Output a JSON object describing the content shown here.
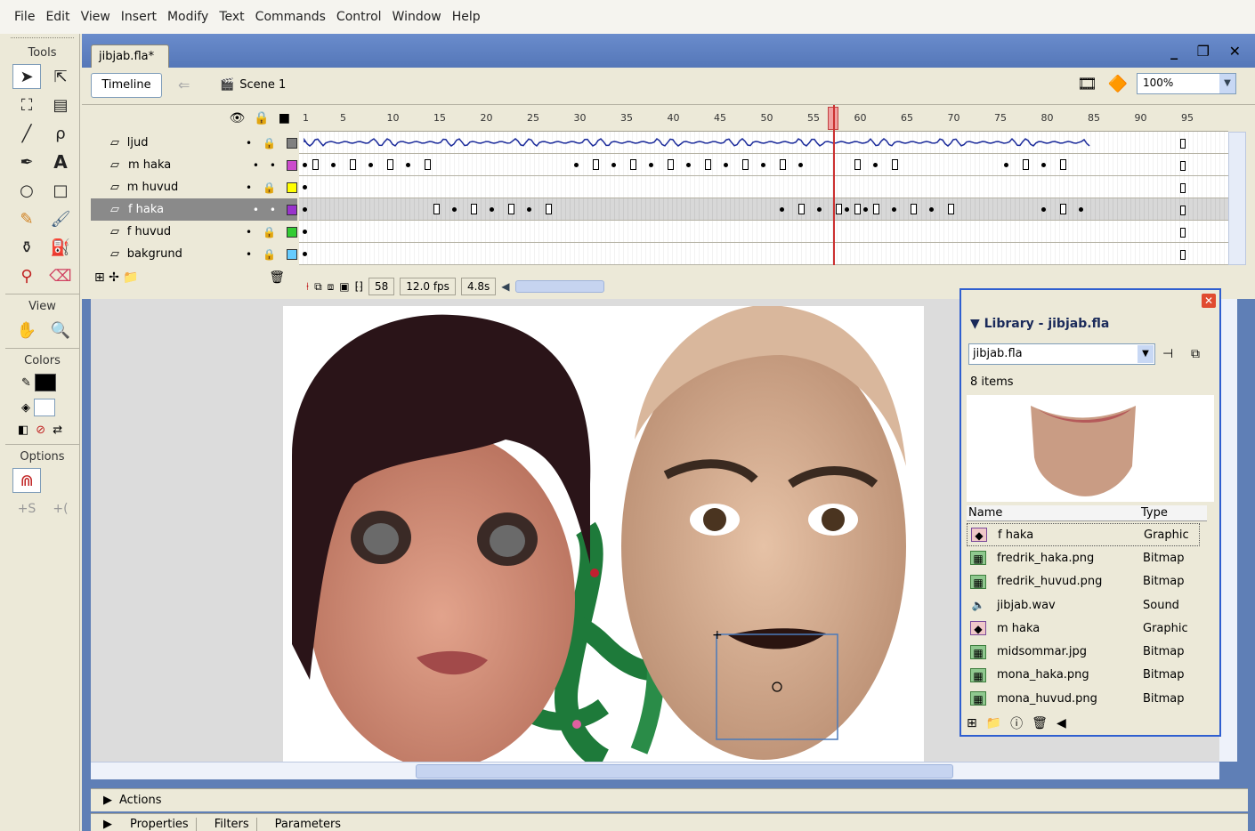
{
  "menu": [
    "File",
    "Edit",
    "View",
    "Insert",
    "Modify",
    "Text",
    "Commands",
    "Control",
    "Window",
    "Help"
  ],
  "tools": {
    "title": "Tools",
    "view_title": "View",
    "colors_title": "Colors",
    "options_title": "Options",
    "stroke_color": "#000000",
    "fill_color": "#ffffff"
  },
  "document": {
    "tab": "jibjab.fla*",
    "timeline_button": "Timeline",
    "scene": "Scene 1",
    "zoom": "100%"
  },
  "timeline": {
    "ruler": [
      "1",
      "5",
      "10",
      "15",
      "20",
      "25",
      "30",
      "35",
      "40",
      "45",
      "50",
      "55",
      "60",
      "65",
      "70",
      "75",
      "80",
      "85",
      "90",
      "95"
    ],
    "layers": [
      {
        "name": "ljud",
        "color": "#808080",
        "selected": false
      },
      {
        "name": "m haka",
        "color": "#cc4ccc",
        "selected": false
      },
      {
        "name": "m huvud",
        "color": "#ffff00",
        "selected": false
      },
      {
        "name": "f haka",
        "color": "#9933cc",
        "selected": true
      },
      {
        "name": "f huvud",
        "color": "#33cc33",
        "selected": false
      },
      {
        "name": "bakgrund",
        "color": "#66ccff",
        "selected": false
      }
    ],
    "current_frame": "58",
    "fps": "12.0 fps",
    "elapsed": "4.8s"
  },
  "library": {
    "title": "Library - jibjab.fla",
    "document": "jibjab.fla",
    "count": "8 items",
    "col_name": "Name",
    "col_type": "Type",
    "items": [
      {
        "name": "f haka",
        "type": "Graphic",
        "icon": "graphic-icon",
        "selected": true
      },
      {
        "name": "fredrik_haka.png",
        "type": "Bitmap",
        "icon": "bitmap-icon",
        "selected": false
      },
      {
        "name": "fredrik_huvud.png",
        "type": "Bitmap",
        "icon": "bitmap-icon",
        "selected": false
      },
      {
        "name": "jibjab.wav",
        "type": "Sound",
        "icon": "sound-icon",
        "selected": false
      },
      {
        "name": "m haka",
        "type": "Graphic",
        "icon": "graphic-icon",
        "selected": false
      },
      {
        "name": "midsommar.jpg",
        "type": "Bitmap",
        "icon": "bitmap-icon",
        "selected": false
      },
      {
        "name": "mona_haka.png",
        "type": "Bitmap",
        "icon": "bitmap-icon",
        "selected": false
      },
      {
        "name": "mona_huvud.png",
        "type": "Bitmap",
        "icon": "bitmap-icon",
        "selected": false
      }
    ]
  },
  "panels": {
    "actions": "Actions",
    "properties": "Properties",
    "filters": "Filters",
    "parameters": "Parameters"
  }
}
